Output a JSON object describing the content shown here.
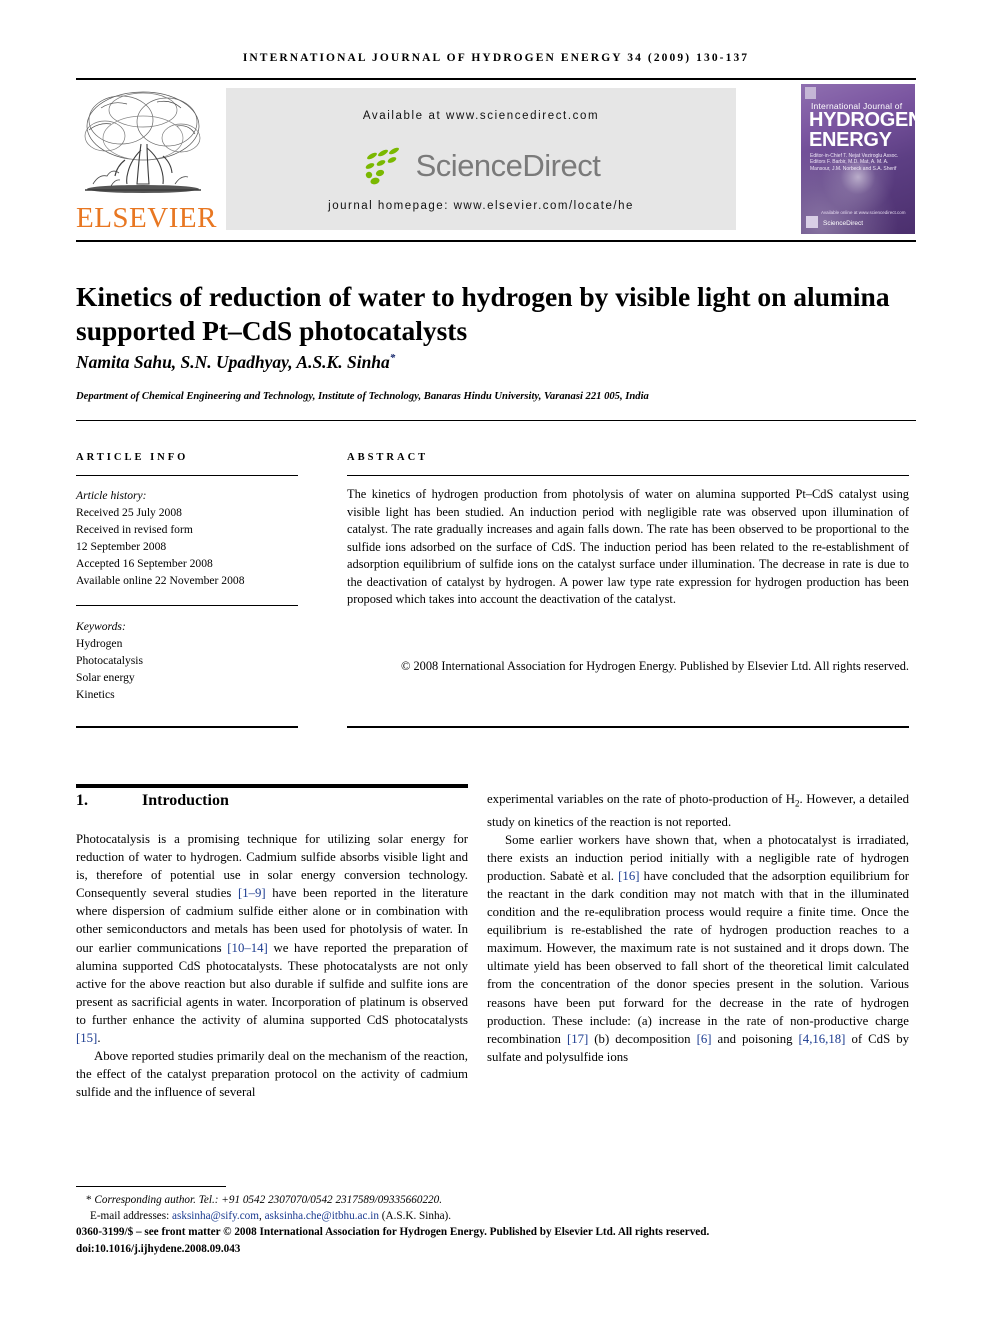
{
  "running_head": "INTERNATIONAL JOURNAL OF HYDROGEN ENERGY 34 (2009) 130-137",
  "masthead": {
    "publisher_name": "ELSEVIER",
    "publisher_logo_icon": "elsevier-tree-icon",
    "available_at": "Available at www.sciencedirect.com",
    "sciencedirect_wordmark": "ScienceDirect",
    "sciencedirect_leaves_icon": "sciencedirect-leaves-icon",
    "journal_homepage": "journal homepage: www.elsevier.com/locate/he",
    "cover": {
      "badge_top_icon": "iahe-badge-icon",
      "badge_bottom_icon": "iahe-badge-icon",
      "line_small": "International Journal of",
      "line1": "International Journal of",
      "line2": "HYDROGEN",
      "line3": "ENERGY",
      "editors": "Editor-in-Chief   T. Nejat Veziroglu\nAssoc. Editors   F. Barbir, M.D. Mat, A. M. A. Mansour, J.M. Norbeck and S.A. Sherif",
      "sciencedirect_label": "ScienceDirect",
      "sciencedirect_small": "Available online at www.sciencedirect.com"
    }
  },
  "article": {
    "title": "Kinetics of reduction of water to hydrogen by visible light on alumina supported Pt–CdS photocatalysts",
    "authors_prefix": "Namita Sahu, S.N. Upadhyay, A.S.K. Sinha",
    "authors_star": "*",
    "affiliation": "Department of Chemical Engineering and Technology, Institute of Technology, Banaras Hindu University, Varanasi 221 005, India"
  },
  "article_info": {
    "heading": "ARTICLE INFO",
    "history_label": "Article history:",
    "history_lines": [
      "Received 25 July 2008",
      "Received in revised form",
      "12 September 2008",
      "Accepted 16 September 2008",
      "Available online 22 November 2008"
    ],
    "keywords_label": "Keywords:",
    "keywords": [
      "Hydrogen",
      "Photocatalysis",
      "Solar energy",
      "Kinetics"
    ]
  },
  "abstract": {
    "heading": "ABSTRACT",
    "text": "The kinetics of hydrogen production from photolysis of water on alumina supported Pt–CdS catalyst using visible light has been studied. An induction period with negligible rate was observed upon illumination of catalyst. The rate gradually increases and again falls down. The rate has been observed to be proportional to the sulfide ions adsorbed on the surface of CdS. The induction period has been related to the re-establishment of adsorption equilibrium of sulfide ions on the catalyst surface under illumination. The decrease in rate is due to the deactivation of catalyst by hydrogen. A power law type rate expression for hydrogen production has been proposed which takes into account the deactivation of the catalyst.",
    "copyright": "© 2008 International Association for Hydrogen Energy. Published by Elsevier Ltd. All rights reserved."
  },
  "section": {
    "number": "1.",
    "title": "Introduction"
  },
  "body": {
    "left_p1_a": "Photocatalysis is a promising technique for utilizing solar energy for reduction of water to hydrogen. Cadmium sulfide absorbs visible light and is, therefore of potential use in solar energy conversion technology. Consequently several studies ",
    "left_p1_ref1": "[1–9]",
    "left_p1_b": " have been reported in the literature where dispersion of cadmium sulfide either alone or in combination with other semiconductors and metals has been used for photolysis of water. In our earlier communications ",
    "left_p1_ref2": "[10–14]",
    "left_p1_c": " we have reported the preparation of alumina supported CdS photocatalysts. These photocatalysts are not only active for the above reaction but also durable if sulfide and sulfite ions are present as sacrificial agents in water. Incorporation of platinum is observed to further enhance the activity of alumina supported CdS photocatalysts ",
    "left_p1_ref3": "[15]",
    "left_p1_d": ".",
    "left_p2": "Above reported studies primarily deal on the mechanism of the reaction, the effect of the catalyst preparation protocol on the activity of cadmium sulfide and the influence of several",
    "right_p1_a": "experimental variables on the rate of photo-production of H",
    "right_p1_sub": "2",
    "right_p1_b": ". However, a detailed study on kinetics of the reaction is not reported.",
    "right_p2_a": "Some earlier workers have shown that, when a photocatalyst is irradiated, there exists an induction period initially with a negligible rate of hydrogen production. Sabatè et al. ",
    "right_p2_ref1": "[16]",
    "right_p2_b": " have concluded that the adsorption equilibrium for the reactant in the dark condition may not match with that in the illuminated condition and the re-equlibration process would require a finite time. Once the equilibrium is re-established the rate of hydrogen production reaches to a maximum. However, the maximum rate is not sustained and it drops down. The ultimate yield has been observed to fall short of the theoretical limit calculated from the concentration of the donor species present in the solution. Various reasons have been put forward for the decrease in the rate of hydrogen production. These include: (a) increase in the rate of non-productive charge recombination ",
    "right_p2_ref2": "[17]",
    "right_p2_c": " (b) decomposition ",
    "right_p2_ref3": "[6]",
    "right_p2_d": " and poisoning ",
    "right_p2_ref4": "[4,16,18]",
    "right_p2_e": " of CdS by sulfate and polysulfide ions"
  },
  "footnotes": {
    "corresponding_star": "*",
    "corresponding_text": "Corresponding author. Tel.: +91 0542 2307070/0542 2317589/09335660220.",
    "email_label": "E-mail addresses:",
    "email1": "asksinha@sify.com",
    "email_sep": ", ",
    "email2": "asksinha.che@itbhu.ac.in",
    "email_tail": " (A.S.K. Sinha).",
    "issn_line": "0360-3199/$ – see front matter © 2008 International Association for Hydrogen Energy. Published by Elsevier Ltd. All rights reserved.",
    "doi_line": "doi:10.1016/j.ijhydene.2008.09.043"
  },
  "colors": {
    "elsevier_orange": "#E87722",
    "sciencedirect_green": "#7AB800",
    "sciencedirect_gray": "#7a7a7a",
    "link_blue": "#1a3a8f",
    "banner_gray": "#e6e6e6",
    "cover_purple": "#6e4a86"
  }
}
